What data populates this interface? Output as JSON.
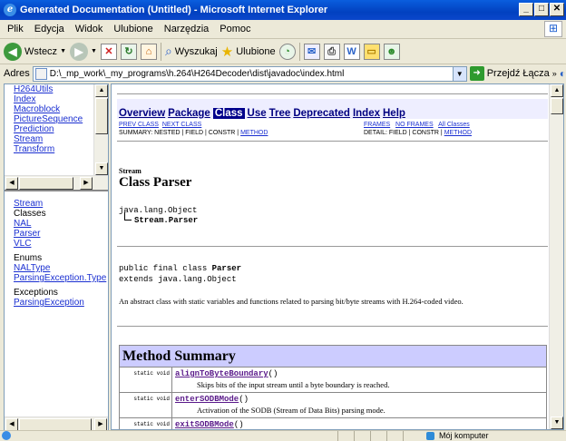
{
  "window": {
    "title": "Generated Documentation (Untitled) - Microsoft Internet Explorer",
    "minimize": "_",
    "maximize": "□",
    "close": "✕"
  },
  "menu": [
    "Plik",
    "Edycja",
    "Widok",
    "Ulubione",
    "Narzędzia",
    "Pomoc"
  ],
  "toolbar": {
    "back": "Wstecz",
    "search": "Wyszukaj",
    "favorites": "Ulubione"
  },
  "address": {
    "label": "Adres",
    "url": "D:\\_mp_work\\_my_programs\\h.264\\H264Decoder\\dist\\javadoc\\index.html",
    "go": "Przejdź",
    "links": "Łącza"
  },
  "top_frame": {
    "items": [
      "H264Utils",
      "Index",
      "Macroblock",
      "PictureSequence",
      "Prediction",
      "Stream",
      "Transform"
    ]
  },
  "bottom_frame": {
    "package": "Stream",
    "classes_h": "Classes",
    "classes": [
      "NAL",
      "Parser",
      "VLC"
    ],
    "enums_h": "Enums",
    "enums": [
      "NALType",
      "ParsingException.Type"
    ],
    "exceptions_h": "Exceptions",
    "exceptions": [
      "ParsingException"
    ]
  },
  "doc": {
    "nav": [
      "Overview",
      "Package",
      "Class",
      "Use",
      "Tree",
      "Deprecated",
      "Index",
      "Help"
    ],
    "prev_class": "PREV CLASS",
    "next_class": "NEXT CLASS",
    "frames": "FRAMES",
    "no_frames": "NO FRAMES",
    "all_classes": "All Classes",
    "summary_prefix": "SUMMARY: NESTED | FIELD | CONSTR | ",
    "detail_prefix": "DETAIL: FIELD | CONSTR | ",
    "method": "METHOD",
    "package": "Stream",
    "class_title": "Class Parser",
    "tree_root": "java.lang.Object",
    "tree_child": "Stream.Parser",
    "decl1_pre": "public final class ",
    "decl1_name": "Parser",
    "decl2": "extends java.lang.Object",
    "description": "An abstract class with static variables and functions related to parsing bit/byte streams with H.264-coded video.",
    "method_summary": "Method Summary",
    "methods": [
      {
        "type": "static void",
        "name": "alignToByteBoundary",
        "sig": "()",
        "desc": "Skips bits of the input stream until a byte boundary is reached."
      },
      {
        "type": "static void",
        "name": "enterSODBMode",
        "sig": "()",
        "desc": "Activation of the SODB (Stream of Data Bits) parsing mode."
      },
      {
        "type": "static void",
        "name": "exitSODBMode",
        "sig": "()",
        "desc": ""
      }
    ]
  },
  "status": {
    "zone": "Mój komputer"
  }
}
